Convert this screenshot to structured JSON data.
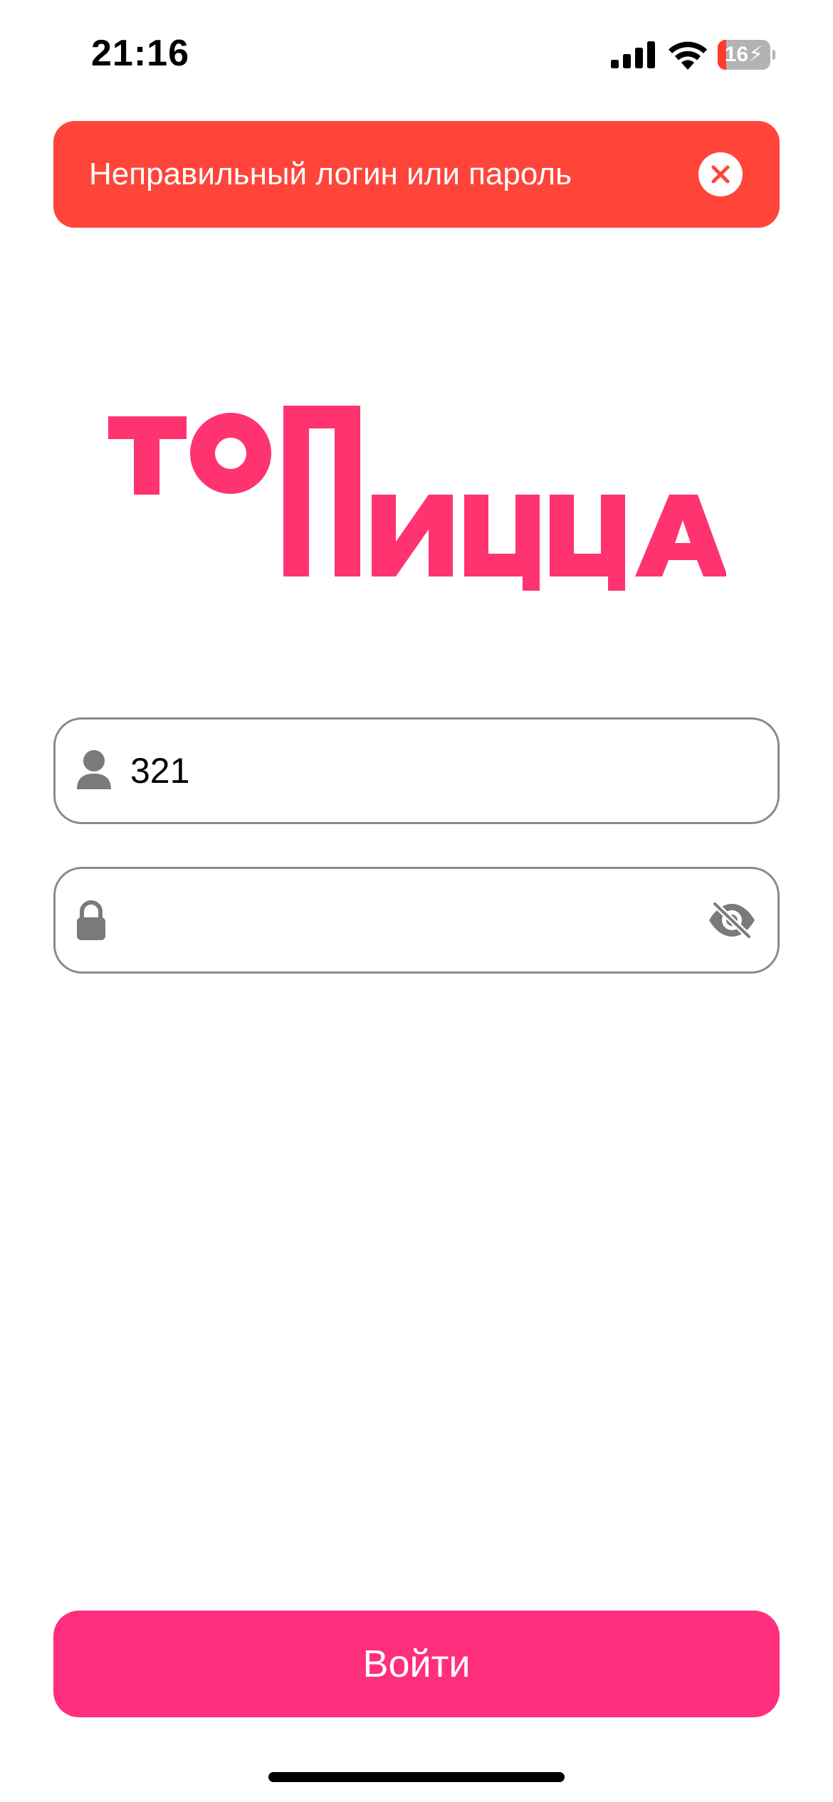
{
  "status_bar": {
    "time": "21:16",
    "battery_level": "16",
    "battery_charging": true,
    "signal_icon": "cellular-signal-icon",
    "wifi_icon": "wifi-icon"
  },
  "error_banner": {
    "message": "Неправильный логин или пароль",
    "close_icon": "close-icon",
    "color": "#ff453a"
  },
  "logo": {
    "line1": "ТО",
    "line2": "ПИЦЦА",
    "brand_color": "#ff3370"
  },
  "login_form": {
    "username": {
      "icon": "person-icon",
      "value": "321"
    },
    "password": {
      "icon": "lock-icon",
      "value": "",
      "visibility_toggle_icon": "eye-slash-icon"
    },
    "submit_label": "Войти",
    "submit_color": "#ff2f7d"
  }
}
